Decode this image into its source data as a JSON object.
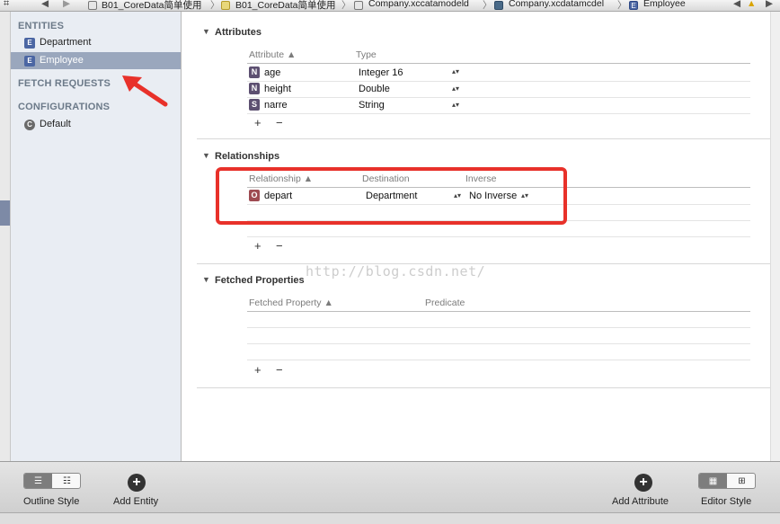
{
  "jumpbar": {
    "items": [
      "B01_CoreData简单使用",
      "B01_CoreData简单使用",
      "Company.xccatamodeld",
      "Company.xcdatamcdel",
      "Employee"
    ],
    "separator": "〉"
  },
  "sidebar": {
    "entities_header": "ENTITIES",
    "entities": [
      {
        "badge": "E",
        "label": "Department"
      },
      {
        "badge": "E",
        "label": "Employee"
      }
    ],
    "fetch_header": "FETCH REQUESTS",
    "configurations_header": "CONFIGURATIONS",
    "configurations": [
      {
        "badge": "C",
        "label": "Default"
      }
    ]
  },
  "attributes": {
    "title": "Attributes",
    "col_attribute": "Attribute ▲",
    "col_type": "Type",
    "rows": [
      {
        "badge": "N",
        "name": "age",
        "type": "Integer 16"
      },
      {
        "badge": "N",
        "name": "height",
        "type": "Double"
      },
      {
        "badge": "S",
        "name": "narre",
        "type": "String"
      }
    ]
  },
  "relationships": {
    "title": "Relationships",
    "col_relationship": "Relationship ▲",
    "col_destination": "Destination",
    "col_inverse": "Inverse",
    "rows": [
      {
        "badge": "O",
        "name": "depart",
        "destination": "Department",
        "inverse": "No Inverse"
      }
    ]
  },
  "fetched": {
    "title": "Fetched Properties",
    "col_property": "Fetched Property ▲",
    "col_predicate": "Predicate"
  },
  "controls": {
    "plus": "+",
    "minus": "−",
    "stepper": "▴▾"
  },
  "watermark": "http://blog.csdn.net/",
  "bottom": {
    "outline_style": "Outline Style",
    "add_entity": "Add Entity",
    "add_attribute": "Add Attribute",
    "editor_style": "Editor Style"
  },
  "colors": {
    "accent_red": "#e8312a",
    "selection": "#9aa7bd"
  },
  "icons": [
    "grid-icon",
    "back-arrow-icon",
    "forward-arrow-icon",
    "folder-icon",
    "model-icon",
    "entity-icon",
    "warning-icon",
    "plus-icon",
    "minus-icon"
  ]
}
